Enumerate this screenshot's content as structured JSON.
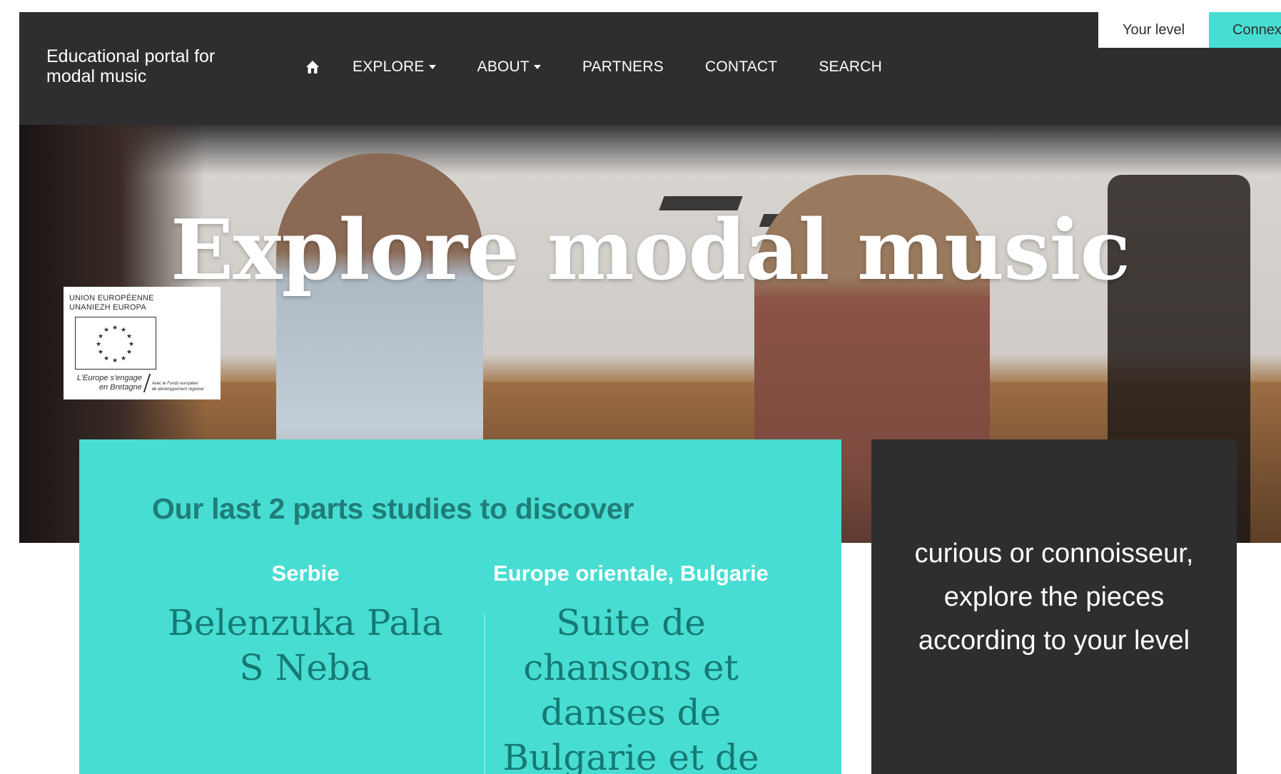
{
  "header": {
    "site_title_line1": "Educational portal for",
    "site_title_line2": "modal music",
    "nav": [
      {
        "label": "EXPLORE",
        "has_dropdown": true
      },
      {
        "label": "ABOUT",
        "has_dropdown": true
      },
      {
        "label": "PARTNERS",
        "has_dropdown": false
      },
      {
        "label": "CONTACT",
        "has_dropdown": false
      },
      {
        "label": "SEARCH",
        "has_dropdown": false
      }
    ],
    "home_icon": "home-icon",
    "btn_level": "Your level",
    "btn_connect": "Connex"
  },
  "hero": {
    "title": "Explore modal music",
    "eu_badge": {
      "line1": "UNION EUROPÉENNE",
      "line2": "UNANIEZH EUROPA",
      "foot_line1": "L'Europe s'engage",
      "foot_line2": "en Bretagne",
      "small_line1": "Avec le Fonds européen",
      "small_line2": "de développement régional"
    }
  },
  "studies": {
    "heading": "Our last 2 parts studies to discover",
    "items": [
      {
        "region": "Serbie",
        "title_lines": [
          "Belenzuka Pala",
          "S Neba"
        ]
      },
      {
        "region": "Europe orientale, Bulgarie",
        "title_lines": [
          "Suite de",
          "chansons et",
          "danses de",
          "Bulgarie et de"
        ]
      }
    ]
  },
  "level_card": {
    "lines": [
      "curious or connoisseur,",
      "explore the pieces",
      "according to your level"
    ]
  },
  "colors": {
    "dark": "#2e2d30",
    "accent": "#48ddd3",
    "accent_text": "#157a73"
  }
}
